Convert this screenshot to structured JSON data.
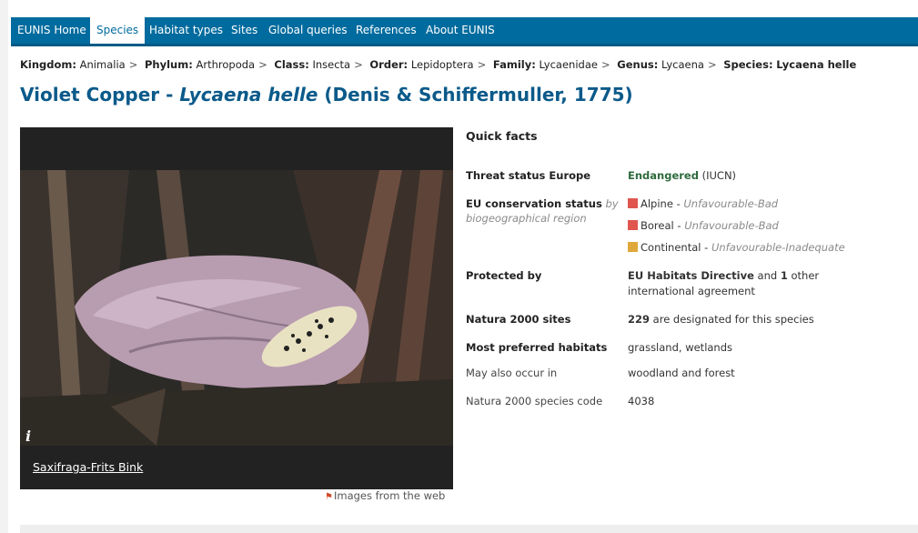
{
  "nav": {
    "tabs": [
      {
        "label": "EUNIS Home",
        "active": false
      },
      {
        "label": "Species",
        "active": true
      },
      {
        "label": "Habitat types",
        "active": false
      },
      {
        "label": "Sites",
        "active": false
      },
      {
        "label": "Global queries",
        "active": false
      },
      {
        "label": "References",
        "active": false
      },
      {
        "label": "About EUNIS",
        "active": false
      }
    ],
    "color": "#006b9e"
  },
  "breadcrumb": [
    {
      "rank": "Kingdom:",
      "value": "Animalia"
    },
    {
      "rank": "Phylum:",
      "value": "Arthropoda"
    },
    {
      "rank": "Class:",
      "value": "Insecta"
    },
    {
      "rank": "Order:",
      "value": "Lepidoptera"
    },
    {
      "rank": "Family:",
      "value": "Lycaenidae"
    },
    {
      "rank": "Genus:",
      "value": "Lycaena"
    },
    {
      "rank": "Species:",
      "value": "Lycaena helle"
    }
  ],
  "breadcrumb_sep": ">",
  "title": {
    "common_name": "Violet Copper",
    "dash": " - ",
    "scientific_name": "Lycaena helle",
    "authority": " (Denis & Schiffermuller, 1775)"
  },
  "photo": {
    "info_icon": "i",
    "caption": "Saxifraga-Frits Bink",
    "web_link": "Images from the web"
  },
  "quick_facts": {
    "heading": "Quick facts",
    "threat": {
      "label": "Threat status Europe",
      "value": "Endangered",
      "source": " (IUCN)"
    },
    "conservation": {
      "label": "EU conservation status",
      "note": " by biogeographical region",
      "items": [
        {
          "region": "Alpine",
          "sep": " - ",
          "status": "Unfavourable-Bad",
          "color": "#e0564f"
        },
        {
          "region": "Boreal",
          "sep": " - ",
          "status": "Unfavourable-Bad",
          "color": "#e0564f"
        },
        {
          "region": "Continental",
          "sep": " - ",
          "status": "Unfavourable-Inadequate",
          "color": "#e0a83a"
        }
      ]
    },
    "protected": {
      "label": "Protected by",
      "directive": "EU Habitats Directive",
      "and": " and ",
      "count": "1",
      "rest": " other international agreement"
    },
    "natura": {
      "label": "Natura 2000 sites",
      "count": "229",
      "rest": " are designated for this species"
    },
    "habitats": {
      "label": "Most preferred habitats",
      "value": "grassland, wetlands"
    },
    "also": {
      "label": "May also occur in",
      "value": "woodland and forest"
    },
    "code": {
      "label": "Natura 2000 species code",
      "value": "4038"
    }
  }
}
